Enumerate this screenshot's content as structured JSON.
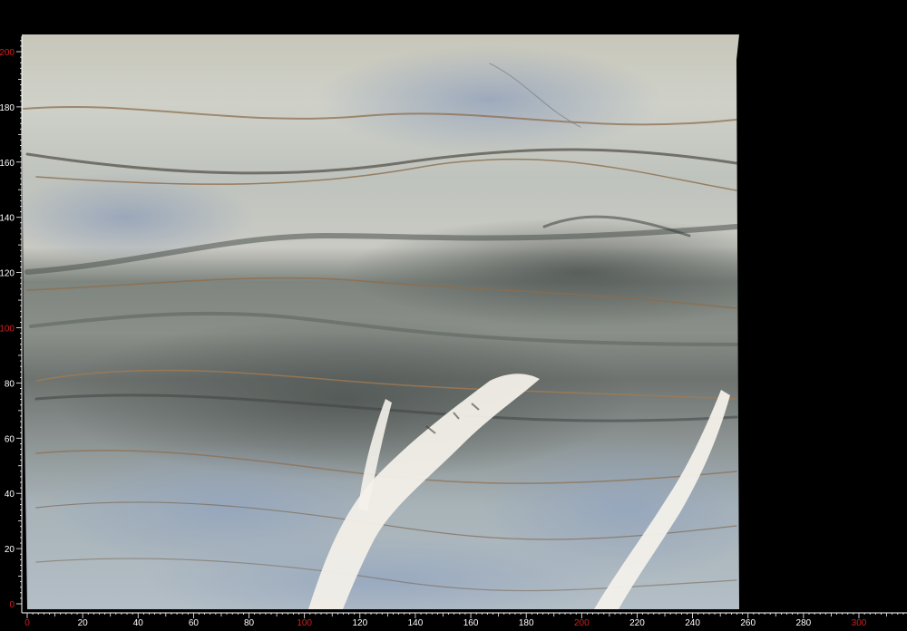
{
  "image": {
    "subject": "stone-slab-photo",
    "background_color": "#000000",
    "ruler_color": "#ffffff",
    "accent_color": "#d02020"
  },
  "ruler": {
    "x_labels": [
      "0",
      "20",
      "40",
      "60",
      "80",
      "100",
      "120",
      "140",
      "160",
      "180",
      "200",
      "220",
      "240",
      "260",
      "280",
      "300"
    ],
    "x_red_labels": [
      "0",
      "100",
      "200",
      "300"
    ],
    "y_labels": [
      "0",
      "20",
      "40",
      "60",
      "80",
      "100",
      "120",
      "140",
      "160",
      "180",
      "200"
    ],
    "y_red_labels": [
      "0",
      "100",
      "200"
    ]
  }
}
